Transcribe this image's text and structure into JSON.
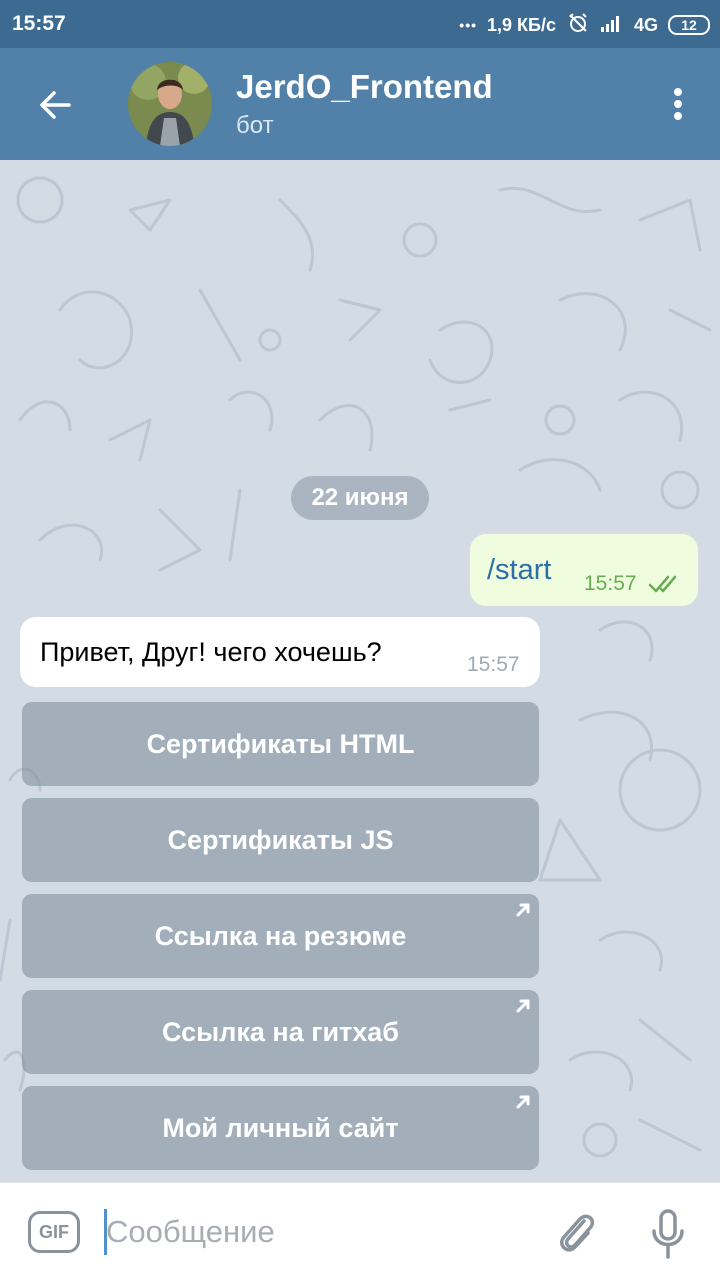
{
  "status_bar": {
    "time": "15:57",
    "dots": "•••",
    "speed": "1,9 КБ/с",
    "network": "4G",
    "battery": "12"
  },
  "header": {
    "title": "JerdO_Frontend",
    "subtitle": "бот",
    "icons": {
      "back": "arrow-back-icon",
      "menu": "more-vert-icon"
    }
  },
  "chat": {
    "date": "22 июня",
    "messages": [
      {
        "direction": "out",
        "text": "/start",
        "time": "15:57",
        "status": "read"
      },
      {
        "direction": "in",
        "text": "Привет, Друг! чего хочешь?",
        "time": "15:57"
      }
    ],
    "keyboard": [
      {
        "label": "Сертификаты HTML",
        "link": false
      },
      {
        "label": "Сертификаты JS",
        "link": false
      },
      {
        "label": "Ссылка на резюме",
        "link": true
      },
      {
        "label": "Ссылка на гитхаб",
        "link": true
      },
      {
        "label": "Мой личный сайт",
        "link": true
      }
    ]
  },
  "input": {
    "gif_label": "GIF",
    "placeholder": "Сообщение",
    "value": ""
  },
  "colors": {
    "status_bar": "#3d6a91",
    "header": "#5181a8",
    "chat_bg": "#d3dbe4",
    "outgoing_bubble": "#effdde",
    "incoming_bubble": "#ffffff",
    "accent": "#4f92cc"
  }
}
